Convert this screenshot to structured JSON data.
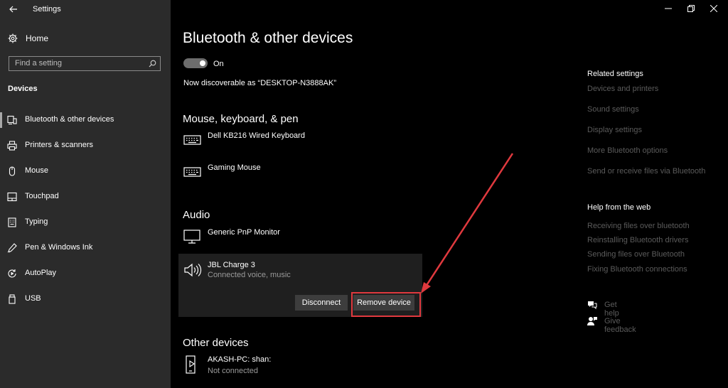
{
  "app": {
    "title": "Settings"
  },
  "sidebar": {
    "home_label": "Home",
    "search_placeholder": "Find a setting",
    "section": "Devices",
    "items": [
      {
        "label": "Bluetooth & other devices",
        "icon": "bluetooth-devices-icon",
        "active": true
      },
      {
        "label": "Printers & scanners",
        "icon": "printer-icon"
      },
      {
        "label": "Mouse",
        "icon": "mouse-icon"
      },
      {
        "label": "Touchpad",
        "icon": "touchpad-icon"
      },
      {
        "label": "Typing",
        "icon": "keyboard-icon"
      },
      {
        "label": "Pen & Windows Ink",
        "icon": "pen-icon"
      },
      {
        "label": "AutoPlay",
        "icon": "autoplay-icon"
      },
      {
        "label": "USB",
        "icon": "usb-icon"
      }
    ]
  },
  "main": {
    "title": "Bluetooth & other devices",
    "toggle_label": "On",
    "discoverable_text": "Now discoverable as “DESKTOP-N3888AK”",
    "groups": {
      "input": {
        "title": "Mouse, keyboard, & pen",
        "devices": [
          {
            "name": "Dell KB216 Wired Keyboard"
          },
          {
            "name": "Gaming Mouse"
          }
        ]
      },
      "audio": {
        "title": "Audio",
        "devices": [
          {
            "name": "Generic PnP Monitor"
          },
          {
            "name": "JBL Charge 3",
            "status": "Connected voice, music"
          }
        ]
      },
      "other": {
        "title": "Other devices",
        "devices": [
          {
            "name": "AKASH-PC: shan:",
            "status": "Not connected"
          }
        ]
      }
    },
    "buttons": {
      "disconnect": "Disconnect",
      "remove": "Remove device"
    }
  },
  "related": {
    "title": "Related settings",
    "links": [
      "Devices and printers",
      "Sound settings",
      "Display settings",
      "More Bluetooth options",
      "Send or receive files via Bluetooth"
    ]
  },
  "web_help": {
    "title": "Help from the web",
    "links": [
      "Receiving files over bluetooth",
      "Reinstalling Bluetooth drivers",
      "Sending files over Bluetooth",
      "Fixing Bluetooth connections"
    ]
  },
  "support": {
    "get_help": "Get help",
    "give_feedback": "Give feedback"
  },
  "colors": {
    "sidebar_bg": "#2b2b2b",
    "main_bg": "#000000",
    "annotation_red": "#e0393e",
    "muted_link": "#5b5b5b"
  }
}
